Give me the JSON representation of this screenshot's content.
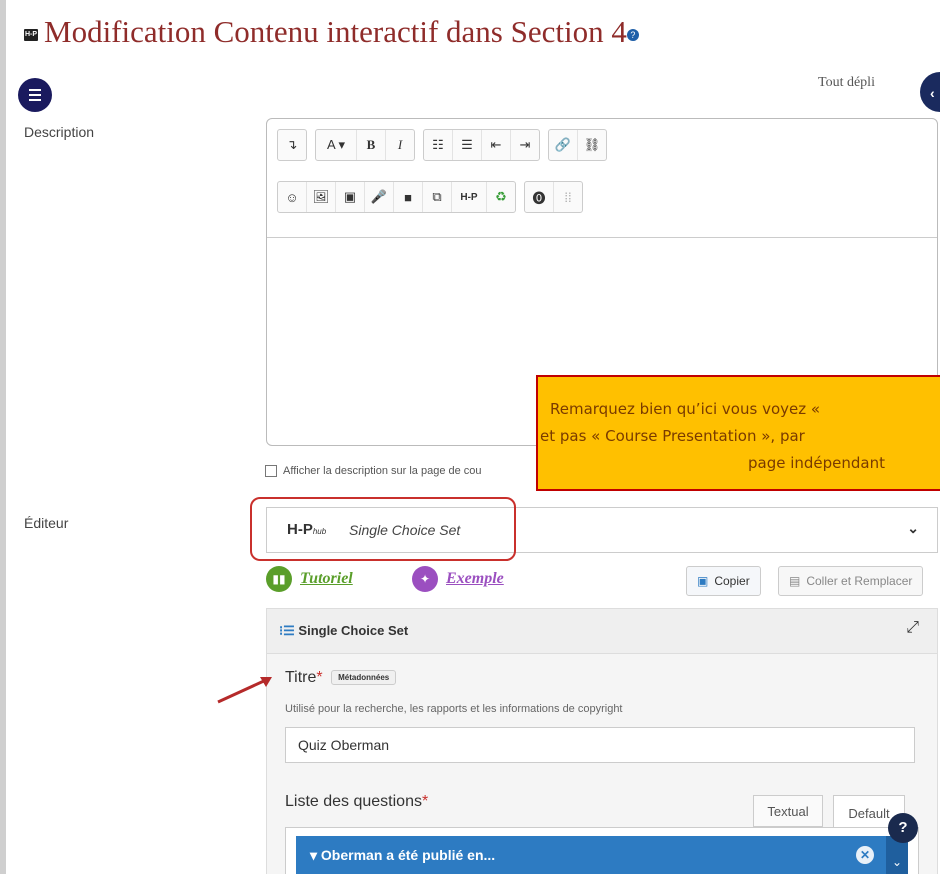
{
  "page": {
    "title": "Modification Contenu interactif dans Section 4",
    "expand_all": "Tout dépli"
  },
  "form": {
    "description_label": "Description",
    "editor_label": "Éditeur",
    "show_description": "Afficher la description sur la page de cou"
  },
  "toolbar": {
    "row1": [
      "↴",
      "A ▾",
      "B",
      "I",
      "☷",
      "☰",
      "⇤",
      "⇥",
      "🔗",
      "⛓"
    ],
    "row2": [
      "☺",
      "🖼",
      "▣",
      "🎤",
      "■",
      "⧉",
      "H-P",
      "♻",
      "⓿",
      "⁞⁞"
    ]
  },
  "callout": {
    "line1": "Remarquez bien qu’ici vous voyez «",
    "line2": "et pas « Course Presentation », par",
    "line3": "page indépendant"
  },
  "h5p": {
    "hub_logo": "H-P",
    "hub_sub": "hub",
    "content_type": "Single Choice Set",
    "tutorial": "Tutoriel",
    "example": "Exemple",
    "copy": "Copier",
    "paste_replace": "Coller et Remplacer"
  },
  "semantics": {
    "header": "Single Choice Set",
    "title_label": "Titre",
    "required": "*",
    "metadata": "Métadonnées",
    "title_desc": "Utilisé pour la recherche, les rapports et les informations de copyright",
    "title_value": "Quiz Oberman",
    "questions_label": "Liste des questions",
    "tab_textual": "Textual",
    "tab_default": "Default",
    "question1": "Oberman a été publié en...",
    "help": "?"
  },
  "colors": {
    "title": "#8f2c2a",
    "callout_bg": "#ffc000",
    "callout_border": "#c00000",
    "question_bar": "#2d7bc2",
    "tutorial_green": "#5a9e2a",
    "example_purple": "#9b4fc0"
  }
}
